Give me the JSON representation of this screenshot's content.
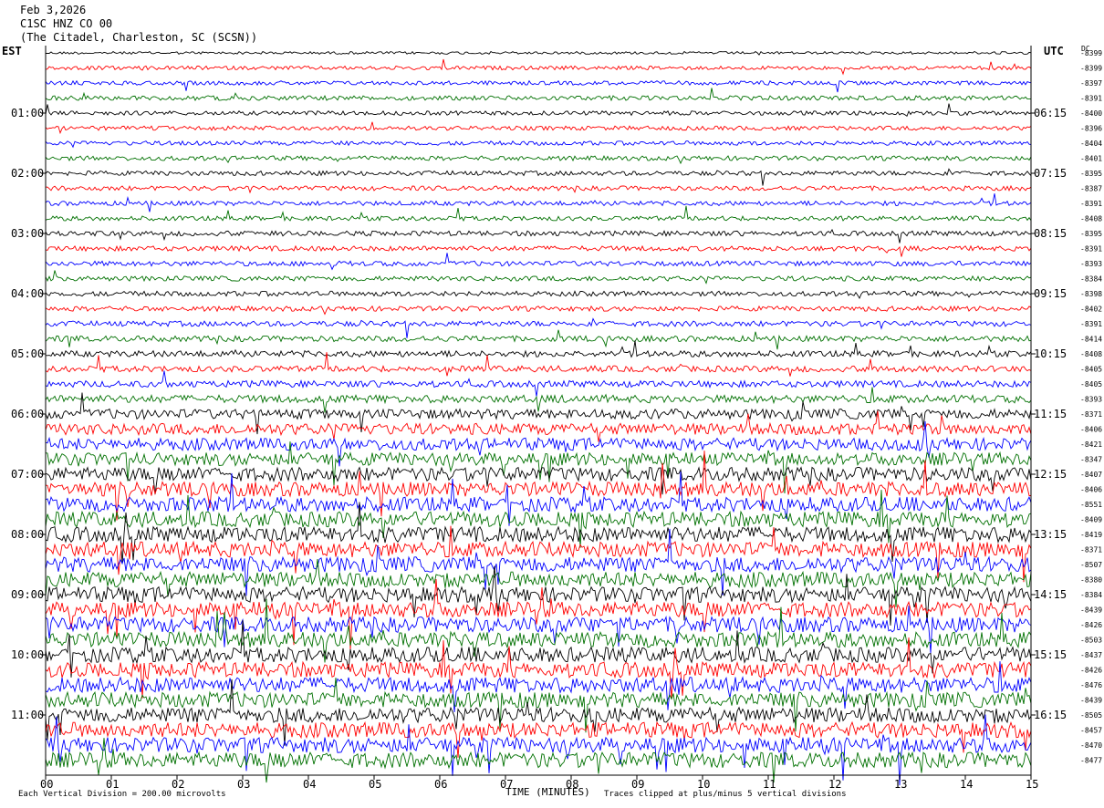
{
  "header": {
    "date": "Feb 3,2026",
    "station": "C1SC HNZ CO 00",
    "location": "(The Citadel, Charleston, SC (SCSN))"
  },
  "footer": {
    "scale_note": "Each Vertical Division = 200.00 microvolts",
    "xlabel": "TIME (MINUTES)",
    "clip_note": "Traces clipped at plus/minus 5 vertical divisions"
  },
  "colors": {
    "trace_cycle": [
      "#000000",
      "#ff0000",
      "#0000ff",
      "#007000"
    ]
  },
  "chart_data": {
    "type": "line",
    "subtype": "helicorder",
    "left_axis_label": "EST",
    "right_axis_label": "UTC",
    "dc_label": "DC",
    "x_ticks": [
      "00",
      "01",
      "02",
      "03",
      "04",
      "05",
      "06",
      "07",
      "08",
      "09",
      "10",
      "11",
      "12",
      "13",
      "14",
      "15"
    ],
    "xlim": [
      0,
      15
    ],
    "left_time_labels": [
      "01:00",
      "02:00",
      "03:00",
      "04:00",
      "05:00",
      "06:00",
      "07:00",
      "08:00",
      "09:00",
      "10:00",
      "11:00"
    ],
    "right_time_labels": [
      "06:15",
      "07:15",
      "08:15",
      "09:15",
      "10:15",
      "11:15",
      "12:15",
      "13:15",
      "14:15",
      "15:15",
      "16:15"
    ],
    "row_minutes": 15,
    "row_count": 48,
    "dc_offsets": [
      -8399,
      -8399,
      -8397,
      -8391,
      -8400,
      -8396,
      -8404,
      -8401,
      -8395,
      -8387,
      -8391,
      -8408,
      -8395,
      -8391,
      -8393,
      -8384,
      -8398,
      -8402,
      -8391,
      -8414,
      -8408,
      -8405,
      -8405,
      -8393,
      -8371,
      -8406,
      -8421,
      -8347,
      -8407,
      -8406,
      -8551,
      -8409,
      -8419,
      -8371,
      -8507,
      -8380,
      -8384,
      -8439,
      -8426,
      -8503,
      -8437,
      -8426,
      -8476,
      -8439,
      -8505,
      -8457,
      -8470,
      -8477
    ],
    "relative_amplitude": [
      0.35,
      0.5,
      0.55,
      0.6,
      0.55,
      0.55,
      0.55,
      0.6,
      0.6,
      0.6,
      0.6,
      0.6,
      0.65,
      0.65,
      0.65,
      0.65,
      0.65,
      0.65,
      0.7,
      0.75,
      0.8,
      0.8,
      0.85,
      1.0,
      1.3,
      1.5,
      1.6,
      1.7,
      1.8,
      1.9,
      1.9,
      2.0,
      2.0,
      2.0,
      2.0,
      2.0,
      2.0,
      2.0,
      2.0,
      2.0,
      2.0,
      2.0,
      2.0,
      2.0,
      2.0,
      2.0,
      2.0,
      2.0
    ]
  }
}
